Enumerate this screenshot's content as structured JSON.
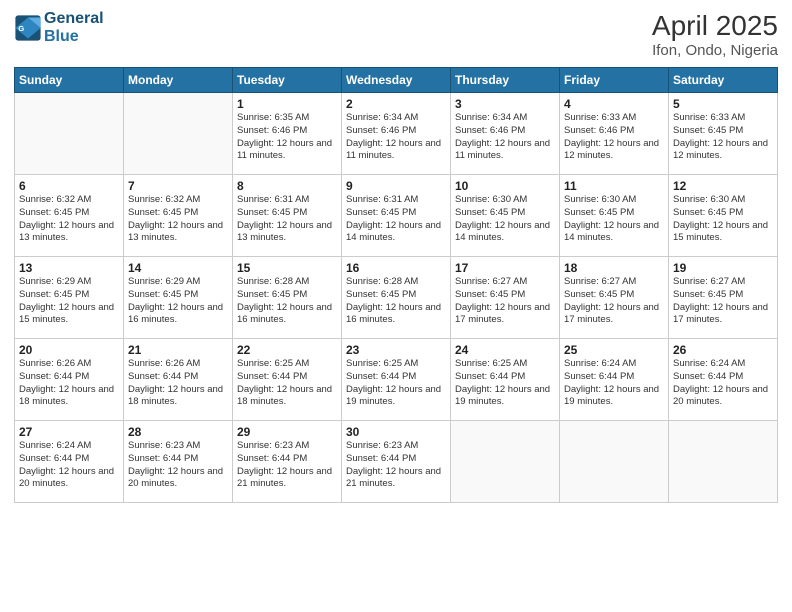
{
  "header": {
    "logo_line1": "General",
    "logo_line2": "Blue",
    "title": "April 2025",
    "subtitle": "Ifon, Ondo, Nigeria"
  },
  "calendar": {
    "days_of_week": [
      "Sunday",
      "Monday",
      "Tuesday",
      "Wednesday",
      "Thursday",
      "Friday",
      "Saturday"
    ],
    "weeks": [
      [
        {
          "day": "",
          "info": ""
        },
        {
          "day": "",
          "info": ""
        },
        {
          "day": "1",
          "info": "Sunrise: 6:35 AM\nSunset: 6:46 PM\nDaylight: 12 hours and 11 minutes."
        },
        {
          "day": "2",
          "info": "Sunrise: 6:34 AM\nSunset: 6:46 PM\nDaylight: 12 hours and 11 minutes."
        },
        {
          "day": "3",
          "info": "Sunrise: 6:34 AM\nSunset: 6:46 PM\nDaylight: 12 hours and 11 minutes."
        },
        {
          "day": "4",
          "info": "Sunrise: 6:33 AM\nSunset: 6:46 PM\nDaylight: 12 hours and 12 minutes."
        },
        {
          "day": "5",
          "info": "Sunrise: 6:33 AM\nSunset: 6:45 PM\nDaylight: 12 hours and 12 minutes."
        }
      ],
      [
        {
          "day": "6",
          "info": "Sunrise: 6:32 AM\nSunset: 6:45 PM\nDaylight: 12 hours and 13 minutes."
        },
        {
          "day": "7",
          "info": "Sunrise: 6:32 AM\nSunset: 6:45 PM\nDaylight: 12 hours and 13 minutes."
        },
        {
          "day": "8",
          "info": "Sunrise: 6:31 AM\nSunset: 6:45 PM\nDaylight: 12 hours and 13 minutes."
        },
        {
          "day": "9",
          "info": "Sunrise: 6:31 AM\nSunset: 6:45 PM\nDaylight: 12 hours and 14 minutes."
        },
        {
          "day": "10",
          "info": "Sunrise: 6:30 AM\nSunset: 6:45 PM\nDaylight: 12 hours and 14 minutes."
        },
        {
          "day": "11",
          "info": "Sunrise: 6:30 AM\nSunset: 6:45 PM\nDaylight: 12 hours and 14 minutes."
        },
        {
          "day": "12",
          "info": "Sunrise: 6:30 AM\nSunset: 6:45 PM\nDaylight: 12 hours and 15 minutes."
        }
      ],
      [
        {
          "day": "13",
          "info": "Sunrise: 6:29 AM\nSunset: 6:45 PM\nDaylight: 12 hours and 15 minutes."
        },
        {
          "day": "14",
          "info": "Sunrise: 6:29 AM\nSunset: 6:45 PM\nDaylight: 12 hours and 16 minutes."
        },
        {
          "day": "15",
          "info": "Sunrise: 6:28 AM\nSunset: 6:45 PM\nDaylight: 12 hours and 16 minutes."
        },
        {
          "day": "16",
          "info": "Sunrise: 6:28 AM\nSunset: 6:45 PM\nDaylight: 12 hours and 16 minutes."
        },
        {
          "day": "17",
          "info": "Sunrise: 6:27 AM\nSunset: 6:45 PM\nDaylight: 12 hours and 17 minutes."
        },
        {
          "day": "18",
          "info": "Sunrise: 6:27 AM\nSunset: 6:45 PM\nDaylight: 12 hours and 17 minutes."
        },
        {
          "day": "19",
          "info": "Sunrise: 6:27 AM\nSunset: 6:45 PM\nDaylight: 12 hours and 17 minutes."
        }
      ],
      [
        {
          "day": "20",
          "info": "Sunrise: 6:26 AM\nSunset: 6:44 PM\nDaylight: 12 hours and 18 minutes."
        },
        {
          "day": "21",
          "info": "Sunrise: 6:26 AM\nSunset: 6:44 PM\nDaylight: 12 hours and 18 minutes."
        },
        {
          "day": "22",
          "info": "Sunrise: 6:25 AM\nSunset: 6:44 PM\nDaylight: 12 hours and 18 minutes."
        },
        {
          "day": "23",
          "info": "Sunrise: 6:25 AM\nSunset: 6:44 PM\nDaylight: 12 hours and 19 minutes."
        },
        {
          "day": "24",
          "info": "Sunrise: 6:25 AM\nSunset: 6:44 PM\nDaylight: 12 hours and 19 minutes."
        },
        {
          "day": "25",
          "info": "Sunrise: 6:24 AM\nSunset: 6:44 PM\nDaylight: 12 hours and 19 minutes."
        },
        {
          "day": "26",
          "info": "Sunrise: 6:24 AM\nSunset: 6:44 PM\nDaylight: 12 hours and 20 minutes."
        }
      ],
      [
        {
          "day": "27",
          "info": "Sunrise: 6:24 AM\nSunset: 6:44 PM\nDaylight: 12 hours and 20 minutes."
        },
        {
          "day": "28",
          "info": "Sunrise: 6:23 AM\nSunset: 6:44 PM\nDaylight: 12 hours and 20 minutes."
        },
        {
          "day": "29",
          "info": "Sunrise: 6:23 AM\nSunset: 6:44 PM\nDaylight: 12 hours and 21 minutes."
        },
        {
          "day": "30",
          "info": "Sunrise: 6:23 AM\nSunset: 6:44 PM\nDaylight: 12 hours and 21 minutes."
        },
        {
          "day": "",
          "info": ""
        },
        {
          "day": "",
          "info": ""
        },
        {
          "day": "",
          "info": ""
        }
      ]
    ]
  }
}
